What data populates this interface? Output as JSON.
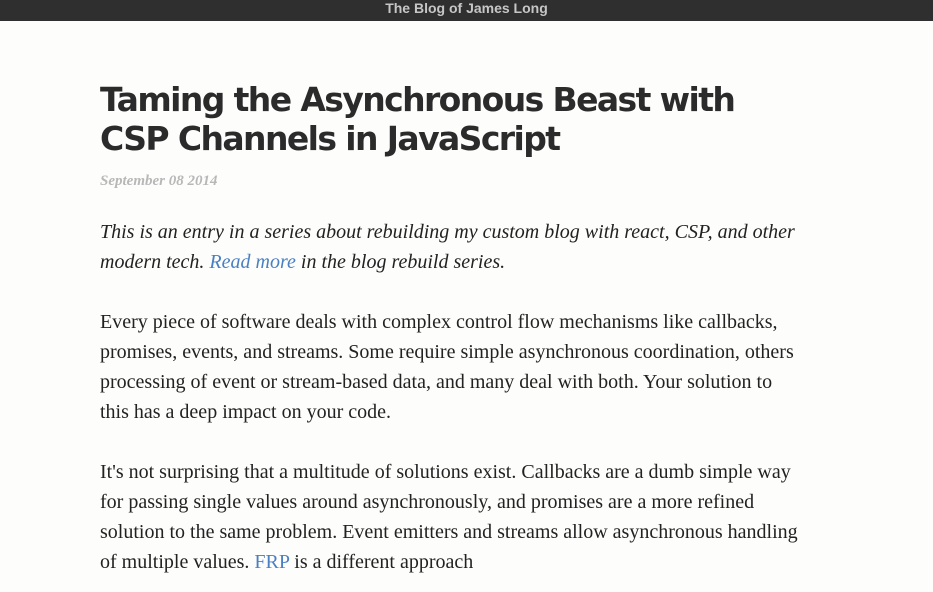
{
  "header": {
    "site_title": "The Blog of James Long"
  },
  "article": {
    "title": "Taming the Asynchronous Beast with CSP Channels in JavaScript",
    "date": "September 08 2014",
    "intro": {
      "before_link": "This is an entry in a series about rebuilding my custom blog with react, CSP, and other modern tech. ",
      "link_text": "Read more",
      "after_link": " in the blog rebuild series."
    },
    "paragraph1": "Every piece of software deals with complex control flow mechanisms like callbacks, promises, events, and streams. Some require simple asynchronous coordination, others processing of event or stream-based data, and many deal with both. Your solution to this has a deep impact on your code.",
    "paragraph2": {
      "before_link": "It's not surprising that a multitude of solutions exist. Callbacks are a dumb simple way for passing single values around asynchronously, and promises are a more refined solution to the same problem. Event emitters and streams allow asynchronous handling of multiple values. ",
      "link_text": "FRP",
      "after_link": " is a different approach"
    }
  },
  "colors": {
    "topbar_bg": "#2f2f2f",
    "page_bg": "#fdfdfb",
    "link": "#4a80c2",
    "date": "#b8b8b8",
    "text": "#222222"
  }
}
